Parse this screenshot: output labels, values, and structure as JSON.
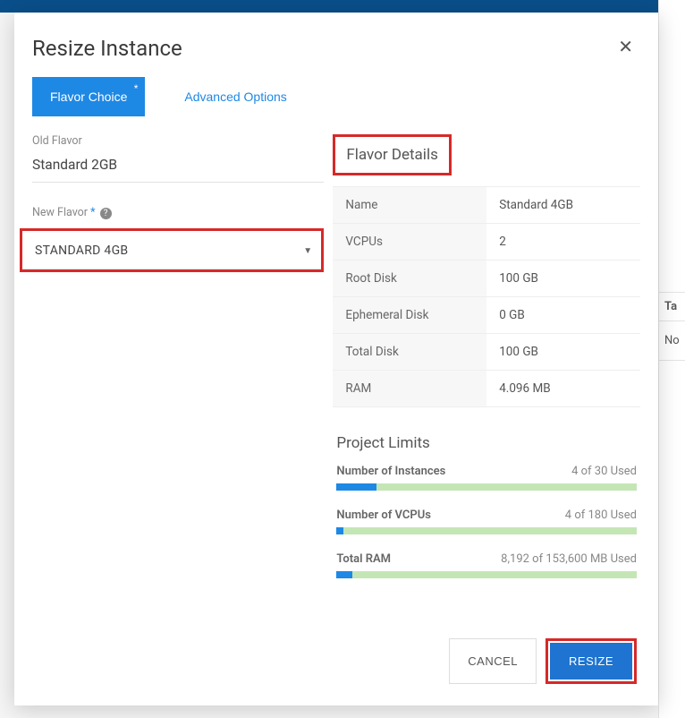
{
  "modal": {
    "title": "Resize Instance"
  },
  "tabs": {
    "flavor_choice": "Flavor Choice",
    "advanced_options": "Advanced Options"
  },
  "left": {
    "old_flavor_label": "Old Flavor",
    "old_flavor_value": "Standard 2GB",
    "new_flavor_label": "New Flavor",
    "new_flavor_value": "STANDARD 4GB"
  },
  "details": {
    "title": "Flavor Details",
    "rows": {
      "name_k": "Name",
      "name_v": "Standard 4GB",
      "vcpus_k": "VCPUs",
      "vcpus_v": "2",
      "root_k": "Root Disk",
      "root_v": "100 GB",
      "eph_k": "Ephemeral Disk",
      "eph_v": "0 GB",
      "tot_k": "Total Disk",
      "tot_v": "100 GB",
      "ram_k": "RAM",
      "ram_v": "4.096 MB"
    }
  },
  "limits": {
    "title": "Project Limits",
    "instances_label": "Number of Instances",
    "instances_used": "4 of 30 Used",
    "vcpus_label": "Number of VCPUs",
    "vcpus_used": "4 of 180 Used",
    "ram_label": "Total RAM",
    "ram_used": "8,192 of 153,600 MB Used"
  },
  "footer": {
    "cancel": "CANCEL",
    "resize": "RESIZE"
  },
  "backdrop": {
    "h1": "Ta",
    "h2": "No"
  }
}
